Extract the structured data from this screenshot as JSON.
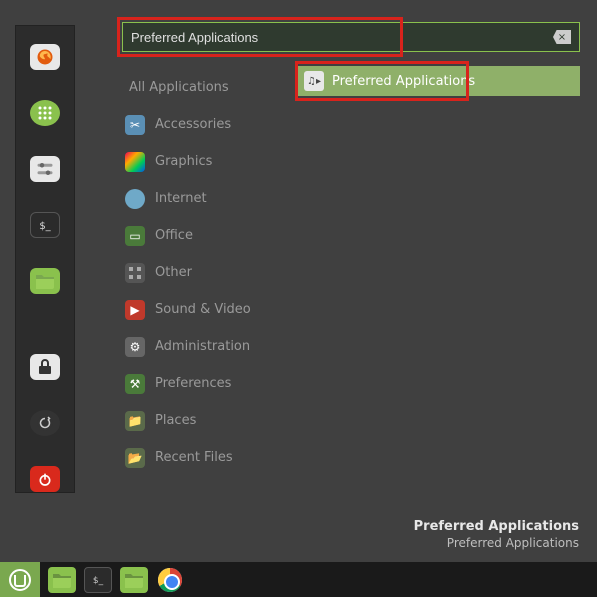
{
  "search": {
    "value": "Preferred Applications",
    "clear_glyph": "×"
  },
  "categories": {
    "all": "All Applications",
    "items": [
      {
        "label": "Accessories",
        "icon": "accessories"
      },
      {
        "label": "Graphics",
        "icon": "graphics"
      },
      {
        "label": "Internet",
        "icon": "internet"
      },
      {
        "label": "Office",
        "icon": "office"
      },
      {
        "label": "Other",
        "icon": "other"
      },
      {
        "label": "Sound & Video",
        "icon": "sound"
      },
      {
        "label": "Administration",
        "icon": "admin"
      },
      {
        "label": "Preferences",
        "icon": "pref"
      },
      {
        "label": "Places",
        "icon": "places"
      },
      {
        "label": "Recent Files",
        "icon": "recent"
      }
    ]
  },
  "result": {
    "label": "Preferred Applications"
  },
  "description": {
    "title": "Preferred Applications",
    "subtitle": "Preferred Applications"
  },
  "favorites": [
    "firefox",
    "software",
    "system-settings",
    "terminal",
    "files",
    "lock",
    "logout",
    "power"
  ],
  "taskbar": [
    "mint-menu",
    "files",
    "terminal",
    "files",
    "chrome"
  ]
}
